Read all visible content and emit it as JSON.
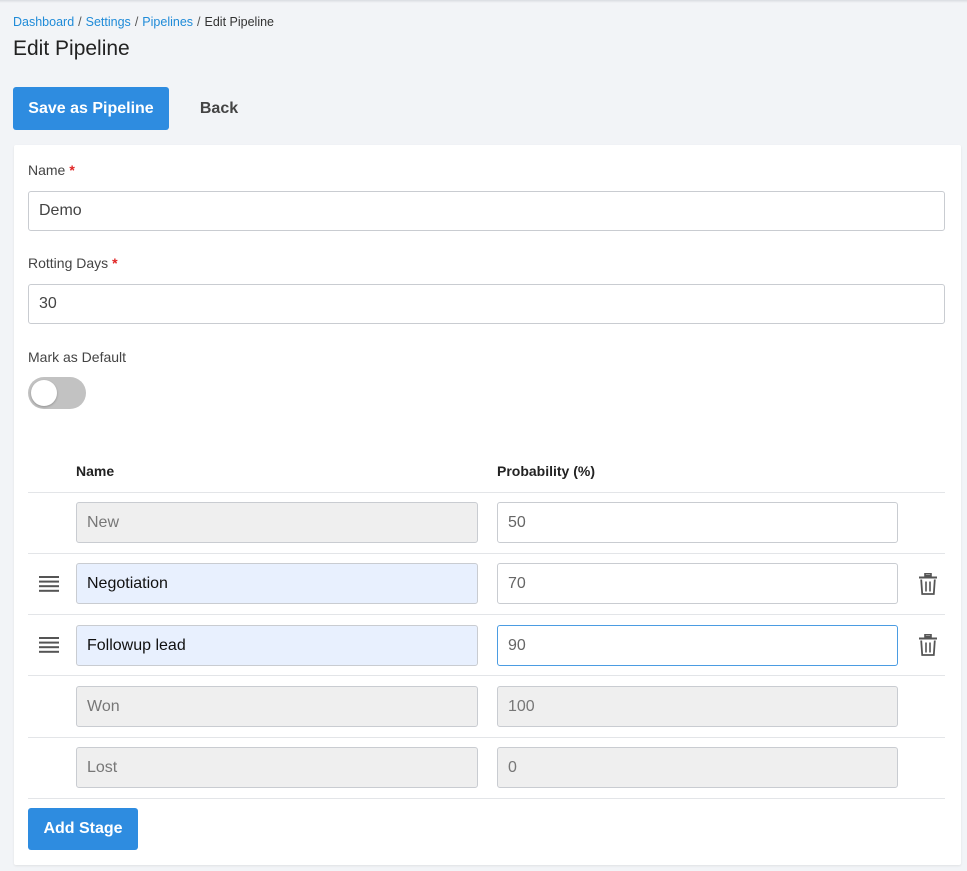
{
  "breadcrumb": {
    "items": [
      "Dashboard",
      "Settings",
      "Pipelines"
    ],
    "current": "Edit Pipeline",
    "separator": "/"
  },
  "page": {
    "title": "Edit Pipeline"
  },
  "toolbar": {
    "save_label": "Save as Pipeline",
    "back_label": "Back"
  },
  "form": {
    "name": {
      "label": "Name",
      "required_mark": "*",
      "value": "Demo"
    },
    "rotting_days": {
      "label": "Rotting Days",
      "required_mark": "*",
      "value": "30"
    },
    "mark_default": {
      "label": "Mark as Default",
      "checked": false
    }
  },
  "stages_table": {
    "headers": {
      "name": "Name",
      "probability": "Probability (%)"
    },
    "rows": [
      {
        "name": "New",
        "probability": "50",
        "draggable": false,
        "deletable": false,
        "name_editable": false,
        "prob_editable": true
      },
      {
        "name": "Negotiation",
        "probability": "70",
        "draggable": true,
        "deletable": true,
        "name_editable": true,
        "prob_editable": true
      },
      {
        "name": "Followup lead",
        "probability": "90",
        "draggable": true,
        "deletable": true,
        "name_editable": true,
        "prob_editable": true,
        "focused": true
      },
      {
        "name": "Won",
        "probability": "100",
        "draggable": false,
        "deletable": false,
        "name_editable": false,
        "prob_editable": false
      },
      {
        "name": "Lost",
        "probability": "0",
        "draggable": false,
        "deletable": false,
        "name_editable": false,
        "prob_editable": false
      }
    ]
  },
  "add_stage_label": "Add Stage",
  "icons": {
    "drag": "drag-handle-icon",
    "delete": "trash-icon"
  },
  "colors": {
    "primary": "#2e8ce0",
    "link": "#1f8bd8",
    "required": "#e02424",
    "highlight": "#e8f0fe"
  }
}
